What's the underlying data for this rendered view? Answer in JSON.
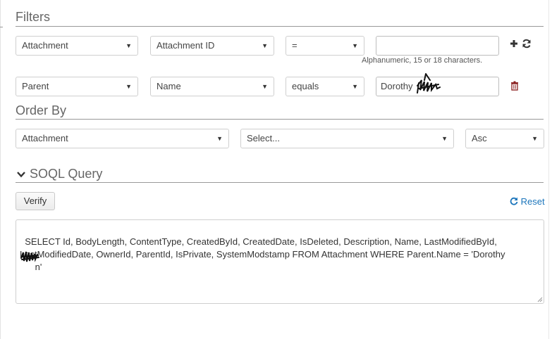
{
  "filters": {
    "title": "Filters",
    "row1": {
      "object": "Attachment",
      "field": "Attachment ID",
      "operator": "=",
      "value": "",
      "hint": "Alphanumeric, 15 or 18 characters."
    },
    "row2": {
      "object": "Parent",
      "field": "Name",
      "operator": "equals",
      "value": "Dorothy"
    },
    "icons": {
      "add": "plus-icon",
      "refresh": "refresh-icon",
      "delete": "trash-icon"
    }
  },
  "order_by": {
    "title": "Order By",
    "object": "Attachment",
    "field_placeholder": "Select...",
    "direction": "Asc"
  },
  "soql": {
    "title": "SOQL Query",
    "verify_label": "Verify",
    "reset_label": "Reset",
    "query_text": "SELECT Id, BodyLength, ContentType, CreatedById, CreatedDate, IsDeleted, Description, Name, LastModifiedById,\nLastModifiedDate, OwnerId, ParentId, IsPrivate, SystemModstamp FROM Attachment WHERE Parent.Name = 'Dorothy\n      n'"
  },
  "colors": {
    "accent": "#1b75bb",
    "trash": "#8b2020"
  }
}
